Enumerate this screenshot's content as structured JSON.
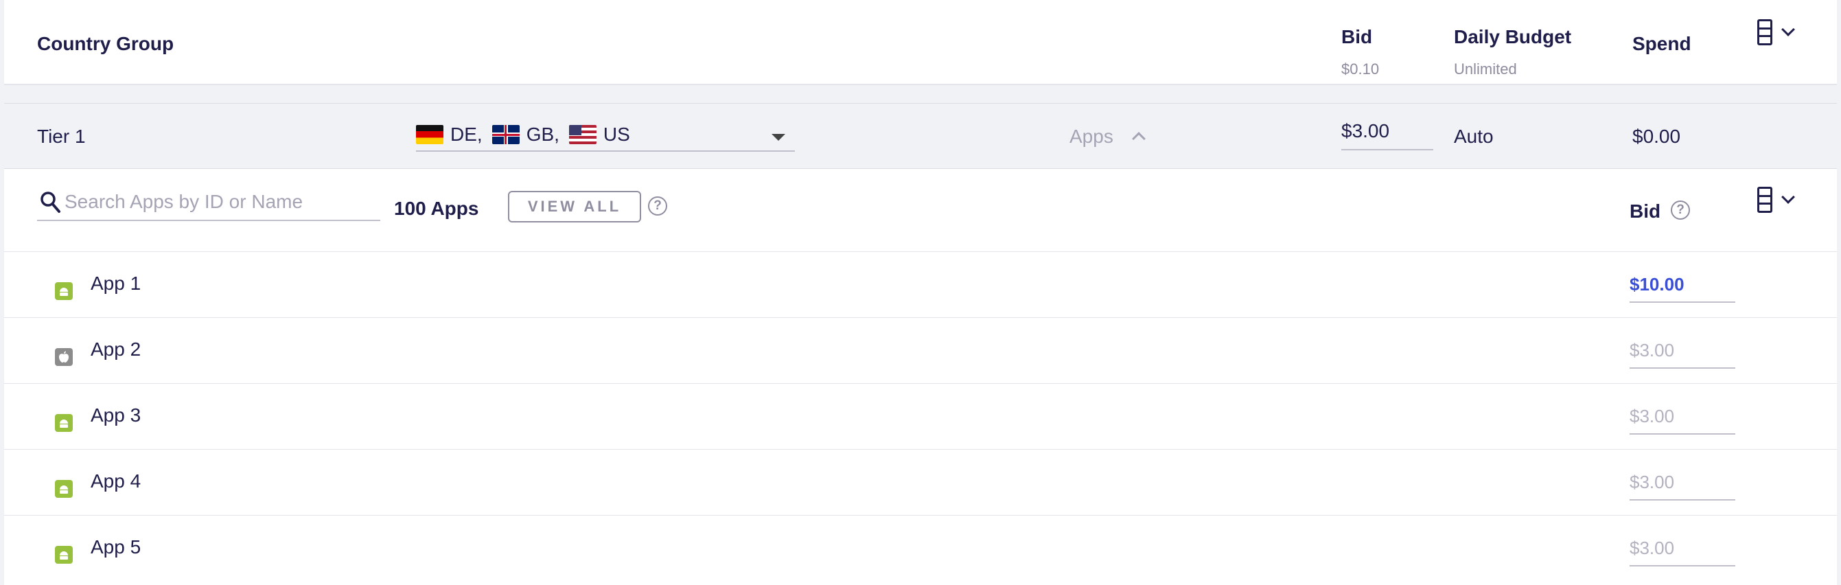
{
  "header": {
    "country_group_label": "Country Group",
    "bid_label": "Bid",
    "bid_value": "$0.10",
    "daily_budget_label": "Daily Budget",
    "daily_budget_value": "Unlimited",
    "spend_label": "Spend"
  },
  "tier": {
    "name": "Tier 1",
    "countries": [
      {
        "code": "DE,",
        "flag": "flag-de"
      },
      {
        "code": "GB,",
        "flag": "flag-gb"
      },
      {
        "code": "US",
        "flag": "flag-us"
      }
    ],
    "apps_toggle_label": "Apps",
    "bid_value": "$3.00",
    "budget_value": "Auto",
    "spend_value": "$0.00"
  },
  "apps_panel": {
    "search_placeholder": "Search Apps by ID or Name",
    "apps_count": "100 Apps",
    "view_all_label": "VIEW ALL",
    "help_glyph": "?",
    "bid_column_label": "Bid"
  },
  "apps": [
    {
      "name": "App 1",
      "os": "android-icon",
      "bid": "$10.00",
      "active": true
    },
    {
      "name": "App 2",
      "os": "apple-icon",
      "bid": "$3.00",
      "active": false
    },
    {
      "name": "App 3",
      "os": "android-icon",
      "bid": "$3.00",
      "active": false
    },
    {
      "name": "App 4",
      "os": "android-icon",
      "bid": "$3.00",
      "active": false
    },
    {
      "name": "App 5",
      "os": "android-icon",
      "bid": "$3.00",
      "active": false
    }
  ],
  "colors": {
    "accent_blue": "#3a4fd8",
    "android_green": "#97c03c",
    "ios_gray": "#8c8c8c",
    "text_dark": "#1f1d4a"
  }
}
